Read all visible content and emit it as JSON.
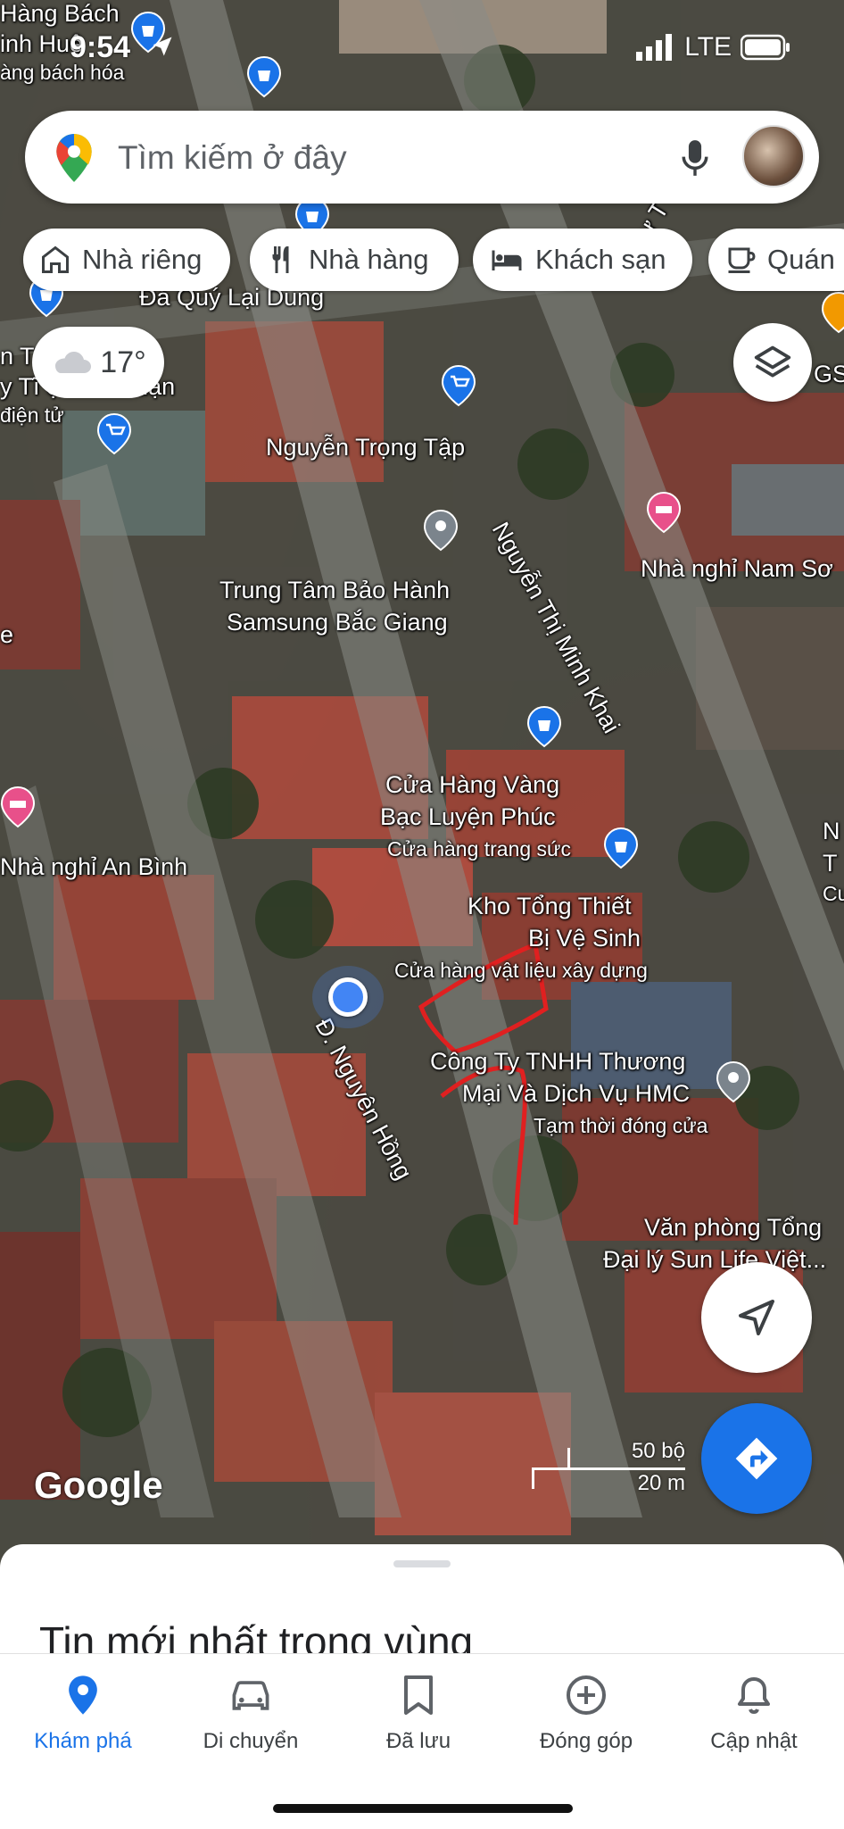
{
  "status_bar": {
    "time": "9:54",
    "network": "LTE"
  },
  "search": {
    "placeholder": "Tìm kiếm ở đây"
  },
  "chips": [
    {
      "label": "Nhà riêng",
      "icon": "home-icon"
    },
    {
      "label": "Nhà hàng",
      "icon": "restaurant-icon"
    },
    {
      "label": "Khách sạn",
      "icon": "hotel-icon"
    },
    {
      "label": "Quán",
      "icon": "cafe-icon"
    }
  ],
  "weather": {
    "temperature": "17°",
    "icon": "cloud-icon"
  },
  "map": {
    "labels": {
      "hang_bach": "Hàng Bách",
      "inh_hue": "inh Huệ",
      "bach_hoa": "àng bách hóa",
      "da_quy": "Đá Quý Lại Dung",
      "n_t": "n T",
      "tran_luan": "y Tĩ      ệ Trần Luận",
      "dien_tu": "điện tử",
      "nguyen_trong_tap": "Nguyễn Trọng Tập",
      "ly_thai": "Lý Tự T",
      "gs": "GS",
      "samsung_1": "Trung Tâm Bảo Hành",
      "samsung_2": "Samsung Bắc Giang",
      "street_nguyen_thi_minh_khai": "Nguyễn Thị Minh Khai",
      "nha_nghi_nam_son": "Nhà nghỉ Nam Sơ",
      "e": "e",
      "vang_1": "Cửa Hàng Vàng",
      "vang_2": "Bạc Luyện Phúc",
      "vang_3": "Cửa hàng trang sức",
      "nha_nghi_an_binh": "Nhà nghỉ An Bình",
      "kho_1": "Kho Tổng Thiết",
      "kho_2": "Bị Vệ Sinh",
      "kho_3": "Cửa hàng vật liệu xây dựng",
      "street_nguyen_hong": "Đ. Nguyên Hồng",
      "cty_1": "Công Ty TNHH Thương",
      "cty_2": "Mại Và Dịch Vụ HMC",
      "cty_3": "Tạm thời đóng cửa",
      "sun_1": "Văn phòng Tổng",
      "sun_2": "Đại lý Sun Life Việt...",
      "right_n": "N",
      "right_t": "T",
      "right_cu": "Cu"
    },
    "scale": {
      "imperial": "50 bộ",
      "metric": "20 m"
    },
    "logo": "Google",
    "colors": {
      "accent": "#1a73e8",
      "location_dot": "#4285f4",
      "annotation": "#e02020"
    }
  },
  "sheet": {
    "title": "Tin mới nhất trong vùng"
  },
  "nav": [
    {
      "label": "Khám phá",
      "icon": "location-pin-icon",
      "active": true
    },
    {
      "label": "Di chuyển",
      "icon": "car-icon",
      "active": false
    },
    {
      "label": "Đã lưu",
      "icon": "bookmark-icon",
      "active": false
    },
    {
      "label": "Đóng góp",
      "icon": "add-circle-icon",
      "active": false
    },
    {
      "label": "Cập nhật",
      "icon": "bell-icon",
      "active": false
    }
  ]
}
